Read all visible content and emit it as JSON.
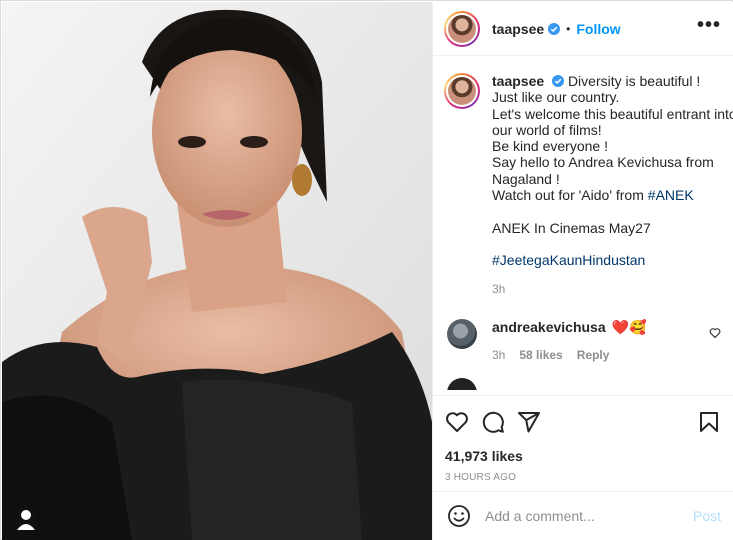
{
  "post": {
    "username": "taapsee",
    "follow_label": "Follow",
    "more_label": "•••",
    "dot": "•"
  },
  "caption": {
    "username": "taapsee",
    "lines": [
      "Diversity is beautiful !",
      "Just like our country.",
      "Let's welcome this beautiful entrant into",
      "our world of films!",
      "Be kind everyone !",
      "Say hello to Andrea Kevichusa from",
      "Nagaland !",
      "Watch out for 'Aido' from "
    ],
    "hashtag_anek": "#ANEK",
    "cinemas_line": "ANEK In Cinemas May27",
    "hashtag_2": "#JeetegaKaunHindustan",
    "time": "3h"
  },
  "comment": {
    "username": "andreakevichusa",
    "emoji": "❤️🥰",
    "time": "3h",
    "likes": "58 likes",
    "reply": "Reply"
  },
  "stats": {
    "likes": "41,973 likes",
    "posted": "3 HOURS AGO"
  },
  "composer": {
    "placeholder": "Add a comment...",
    "post_label": "Post"
  },
  "icons": {
    "like": "heart-icon",
    "comment": "comment-icon",
    "share": "share-icon",
    "save": "bookmark-icon",
    "emoji": "emoji-icon",
    "tag": "user-tag-icon",
    "verified": "verified-badge-icon"
  },
  "colors": {
    "link": "#0095f6",
    "hashtag": "#00376b",
    "muted": "#8e8e8e"
  }
}
